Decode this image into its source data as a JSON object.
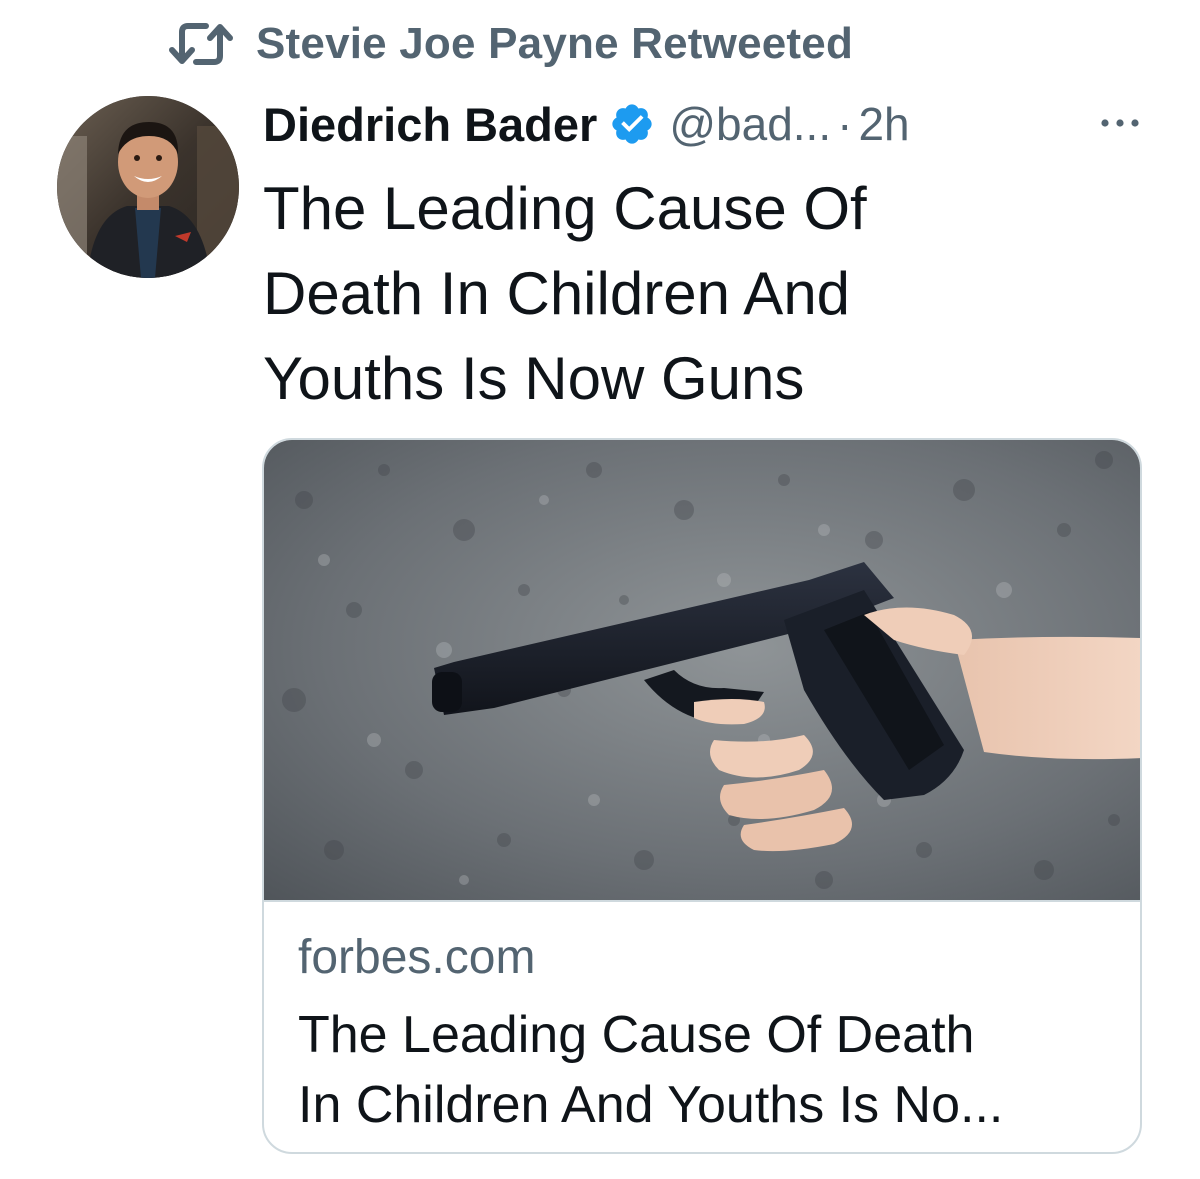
{
  "retweet": {
    "icon": "retweet-icon",
    "text": "Stevie Joe Payne Retweeted"
  },
  "tweet": {
    "author_name": "Diedrich Bader",
    "verified": true,
    "verified_icon": "verified-badge-icon",
    "handle": "@bad...",
    "separator": "·",
    "time": "2h",
    "more_icon": "more-options-icon",
    "text_lines": [
      "The Leading Cause Of",
      "Death In Children And",
      "Youths Is Now Guns"
    ]
  },
  "card": {
    "domain": "forbes.com",
    "title_lines": [
      "The Leading Cause Of Death",
      "In Children And Youths Is No..."
    ]
  },
  "colors": {
    "text_primary": "#0f1419",
    "text_secondary": "#536471",
    "verified_blue": "#1d9bf0",
    "border": "#cfd9de"
  }
}
